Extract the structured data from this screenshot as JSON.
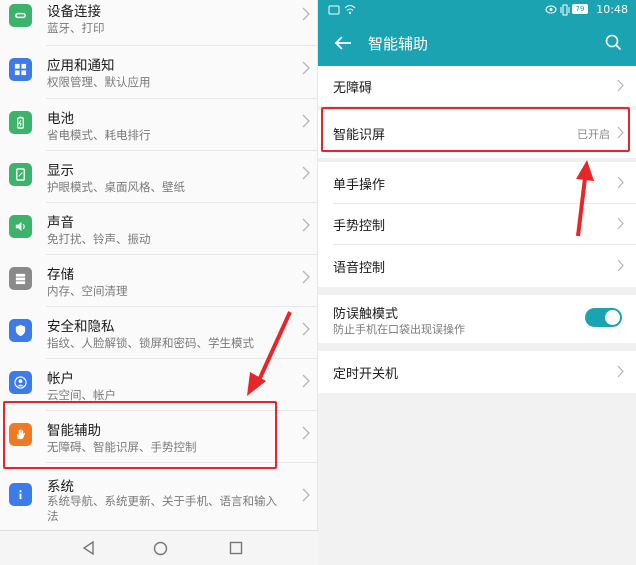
{
  "left": {
    "items": [
      {
        "title": "设备连接",
        "subtitle": "蓝牙、打印",
        "icon": "link-icon",
        "color": "#3bb36a"
      },
      {
        "title": "应用和通知",
        "subtitle": "权限管理、默认应用",
        "icon": "apps-grid-icon",
        "color": "#3d7be8"
      },
      {
        "title": "电池",
        "subtitle": "省电模式、耗电排行",
        "icon": "battery-icon",
        "color": "#3bb36a"
      },
      {
        "title": "显示",
        "subtitle": "护眼模式、桌面风格、壁纸",
        "icon": "display-icon",
        "color": "#3bb36a"
      },
      {
        "title": "声音",
        "subtitle": "免打扰、铃声、振动",
        "icon": "speaker-icon",
        "color": "#3bb36a"
      },
      {
        "title": "存储",
        "subtitle": "内存、空间清理",
        "icon": "storage-icon",
        "color": "#8a8a8a"
      },
      {
        "title": "安全和隐私",
        "subtitle": "指纹、人脸解锁、锁屏和密码、学生模式",
        "icon": "shield-icon",
        "color": "#3d7be8"
      },
      {
        "title": "帐户",
        "subtitle": "云空间、帐户",
        "icon": "person-icon",
        "color": "#3d7be8"
      },
      {
        "title": "智能辅助",
        "subtitle": "无障碍、智能识屏、手势控制",
        "icon": "hand-icon",
        "color": "#f07a24"
      },
      {
        "title": "系统",
        "subtitle": "系统导航、系统更新、关于手机、语言和输入",
        "subtitle2": "法",
        "icon": "info-icon",
        "color": "#3d7be8"
      }
    ]
  },
  "statusbar": {
    "time": "10:48",
    "battery": "79"
  },
  "right": {
    "title": "智能辅助",
    "items": [
      {
        "label": "无障碍"
      },
      {
        "label": "智能识屏",
        "value": "已开启"
      },
      {
        "label": "单手操作"
      },
      {
        "label": "手势控制"
      },
      {
        "label": "语音控制"
      },
      {
        "label": "防误触模式",
        "subtitle": "防止手机在口袋出现误操作",
        "toggle": true
      },
      {
        "label": "定时开关机"
      }
    ]
  },
  "colors": {
    "accent": "#1ba3b2",
    "highlight": "#e8262a"
  }
}
